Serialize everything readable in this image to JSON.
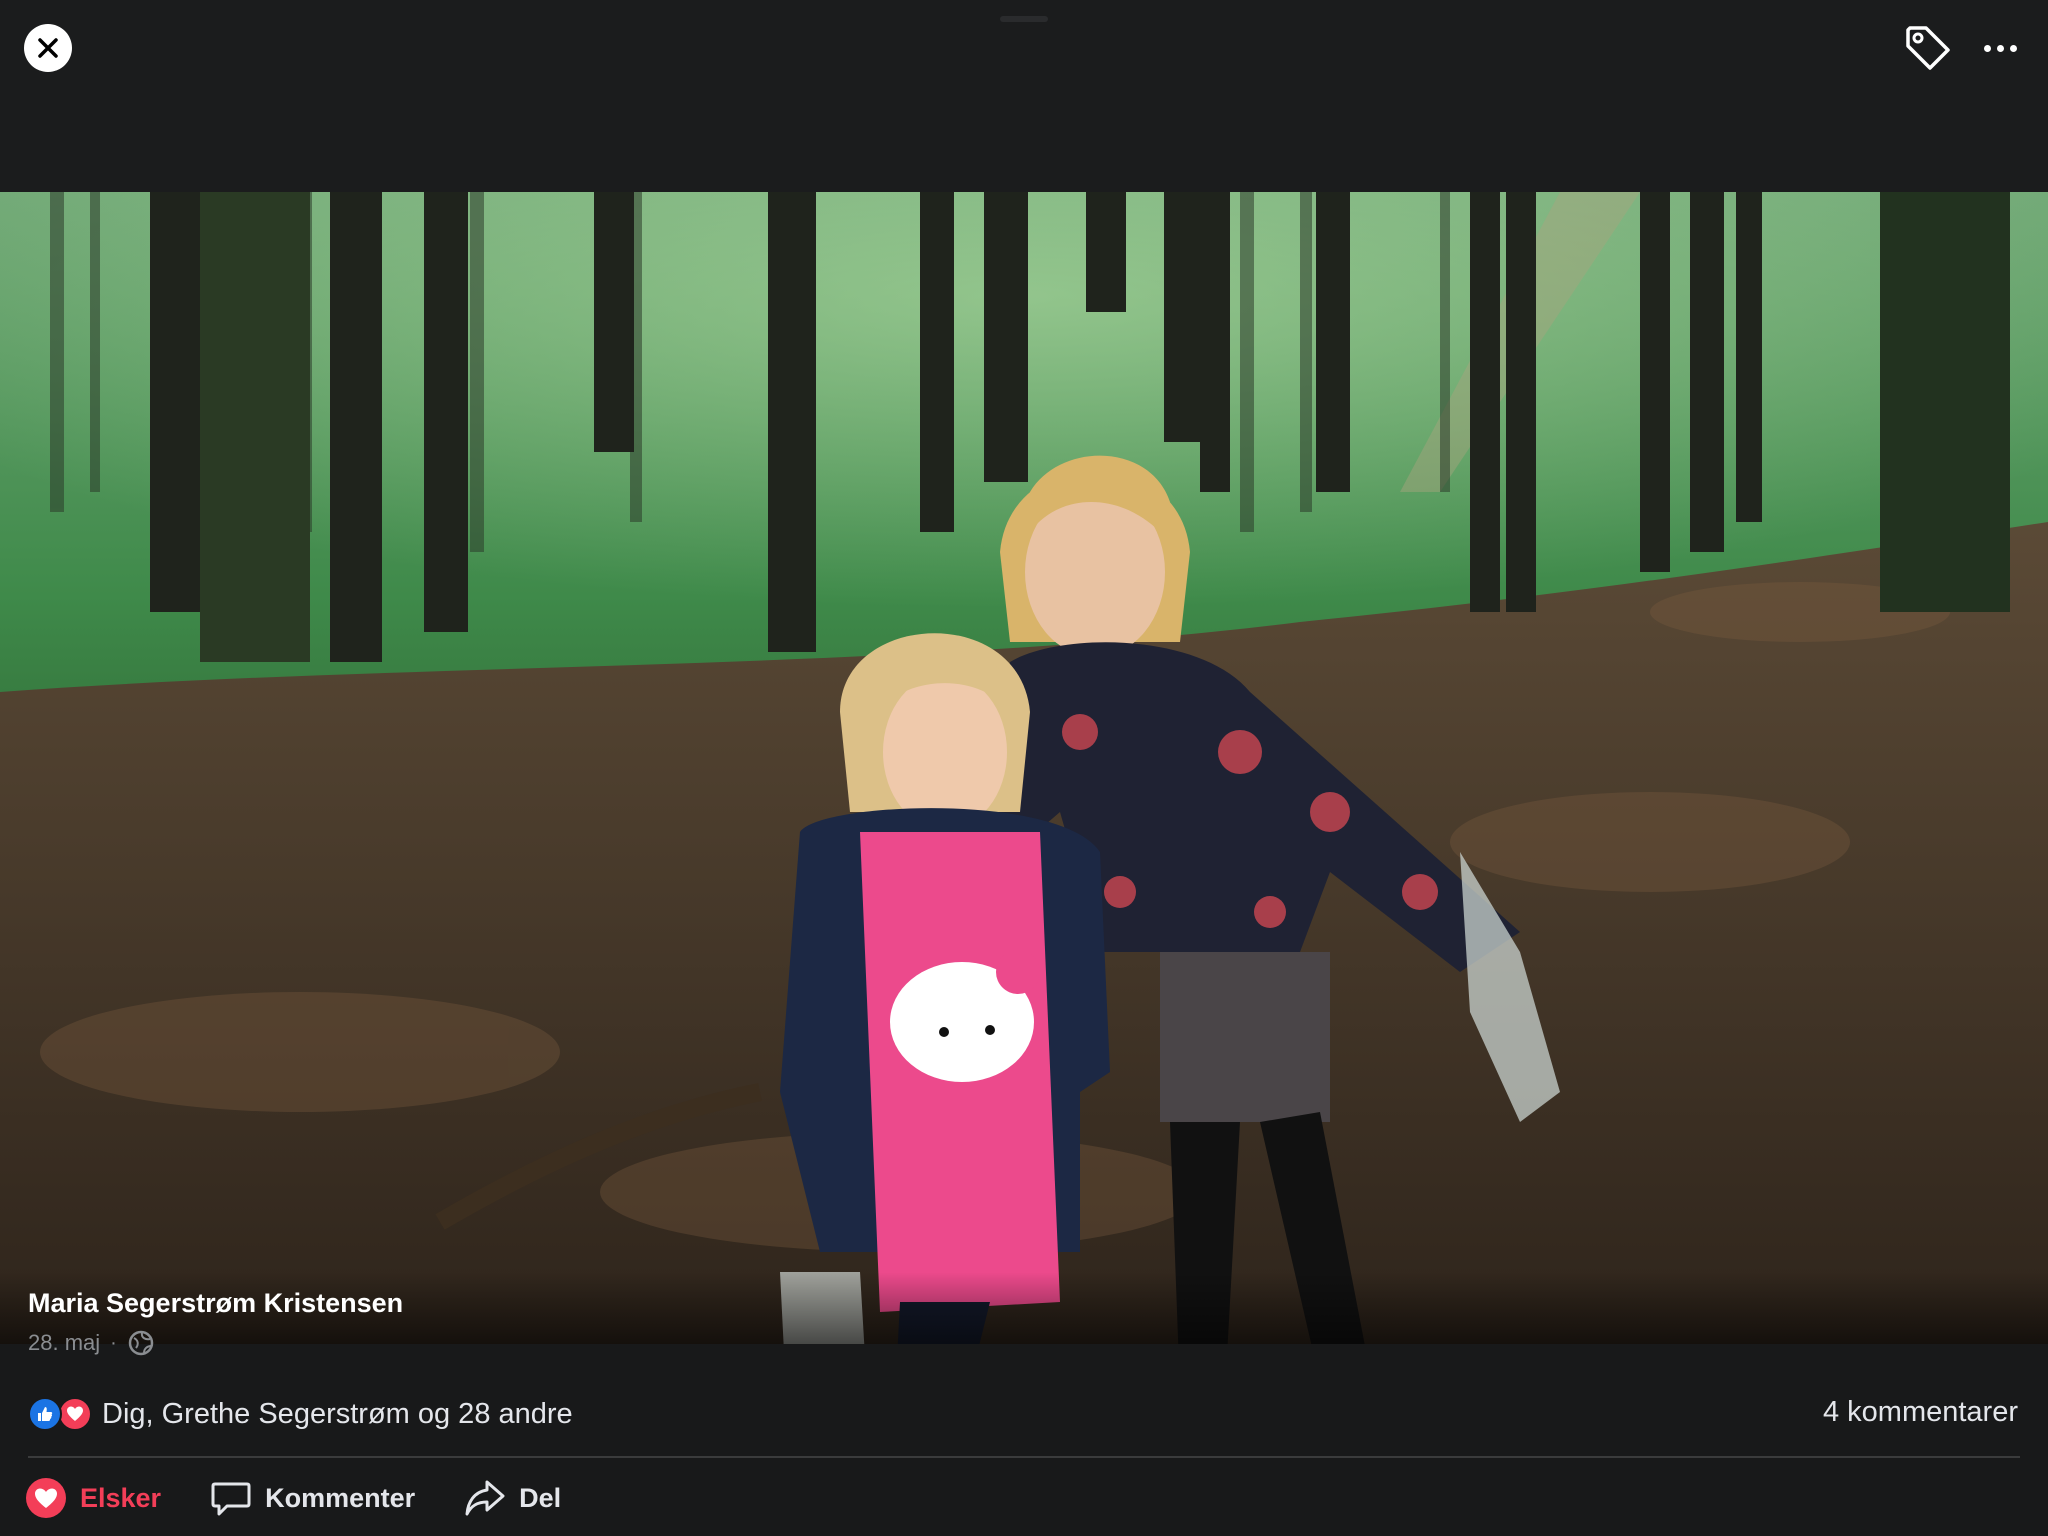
{
  "header": {
    "close_icon": "close-icon",
    "tag_icon": "tag-icon",
    "more_icon": "more-horizontal-icon"
  },
  "post": {
    "author": "Maria Segerstrøm Kristensen",
    "date": "28. maj",
    "separator": "·",
    "privacy_icon": "globe-icon",
    "photo_description_icon": "photo"
  },
  "engagement": {
    "reactions_text": "Dig, Grethe Segerstrøm og 28 andre",
    "reaction_types": [
      "like-icon",
      "love-icon"
    ],
    "comments_text": "4 kommentarer"
  },
  "actions": {
    "love_label": "Elsker",
    "comment_label": "Kommenter",
    "share_label": "Del"
  },
  "colors": {
    "background": "#18191a",
    "love_red": "#f33e58",
    "like_blue": "#1b74e4",
    "secondary_text": "#8a8d91"
  }
}
